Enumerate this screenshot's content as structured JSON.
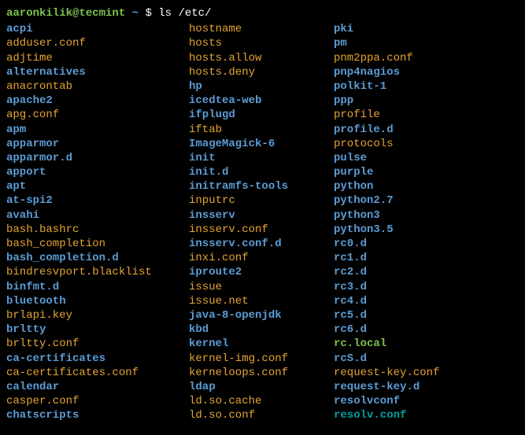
{
  "prompt": {
    "user_host": "aaronkilik@tecmint",
    "tilde": "~",
    "dollar": "$",
    "command": "ls /etc/"
  },
  "columns": [
    [
      {
        "name": "acpi",
        "type": "dir"
      },
      {
        "name": "adduser.conf",
        "type": "file"
      },
      {
        "name": "adjtime",
        "type": "file"
      },
      {
        "name": "alternatives",
        "type": "dir"
      },
      {
        "name": "anacrontab",
        "type": "file"
      },
      {
        "name": "apache2",
        "type": "dir"
      },
      {
        "name": "apg.conf",
        "type": "file"
      },
      {
        "name": "apm",
        "type": "dir"
      },
      {
        "name": "apparmor",
        "type": "dir"
      },
      {
        "name": "apparmor.d",
        "type": "dir"
      },
      {
        "name": "apport",
        "type": "dir"
      },
      {
        "name": "apt",
        "type": "dir"
      },
      {
        "name": "at-spi2",
        "type": "dir"
      },
      {
        "name": "avahi",
        "type": "dir"
      },
      {
        "name": "bash.bashrc",
        "type": "file"
      },
      {
        "name": "bash_completion",
        "type": "file"
      },
      {
        "name": "bash_completion.d",
        "type": "dir"
      },
      {
        "name": "bindresvport.blacklist",
        "type": "file"
      },
      {
        "name": "binfmt.d",
        "type": "dir"
      },
      {
        "name": "bluetooth",
        "type": "dir"
      },
      {
        "name": "brlapi.key",
        "type": "file"
      },
      {
        "name": "brltty",
        "type": "dir"
      },
      {
        "name": "brltty.conf",
        "type": "file"
      },
      {
        "name": "ca-certificates",
        "type": "dir"
      },
      {
        "name": "ca-certificates.conf",
        "type": "file"
      },
      {
        "name": "calendar",
        "type": "dir"
      },
      {
        "name": "casper.conf",
        "type": "file"
      },
      {
        "name": "chatscripts",
        "type": "dir"
      }
    ],
    [
      {
        "name": "hostname",
        "type": "file"
      },
      {
        "name": "hosts",
        "type": "file"
      },
      {
        "name": "hosts.allow",
        "type": "file"
      },
      {
        "name": "hosts.deny",
        "type": "file"
      },
      {
        "name": "hp",
        "type": "dir"
      },
      {
        "name": "icedtea-web",
        "type": "dir"
      },
      {
        "name": "ifplugd",
        "type": "dir"
      },
      {
        "name": "iftab",
        "type": "file"
      },
      {
        "name": "ImageMagick-6",
        "type": "dir"
      },
      {
        "name": "init",
        "type": "dir"
      },
      {
        "name": "init.d",
        "type": "dir"
      },
      {
        "name": "initramfs-tools",
        "type": "dir"
      },
      {
        "name": "inputrc",
        "type": "file"
      },
      {
        "name": "insserv",
        "type": "dir"
      },
      {
        "name": "insserv.conf",
        "type": "file"
      },
      {
        "name": "insserv.conf.d",
        "type": "dir"
      },
      {
        "name": "inxi.conf",
        "type": "file"
      },
      {
        "name": "iproute2",
        "type": "dir"
      },
      {
        "name": "issue",
        "type": "file"
      },
      {
        "name": "issue.net",
        "type": "file"
      },
      {
        "name": "java-8-openjdk",
        "type": "dir"
      },
      {
        "name": "kbd",
        "type": "dir"
      },
      {
        "name": "kernel",
        "type": "dir"
      },
      {
        "name": "kernel-img.conf",
        "type": "file"
      },
      {
        "name": "kerneloops.conf",
        "type": "file"
      },
      {
        "name": "ldap",
        "type": "dir"
      },
      {
        "name": "ld.so.cache",
        "type": "file"
      },
      {
        "name": "ld.so.conf",
        "type": "file"
      }
    ],
    [
      {
        "name": "pki",
        "type": "dir"
      },
      {
        "name": "pm",
        "type": "dir"
      },
      {
        "name": "pnm2ppa.conf",
        "type": "file"
      },
      {
        "name": "pnp4nagios",
        "type": "dir"
      },
      {
        "name": "polkit-1",
        "type": "dir"
      },
      {
        "name": "ppp",
        "type": "dir"
      },
      {
        "name": "profile",
        "type": "file"
      },
      {
        "name": "profile.d",
        "type": "dir"
      },
      {
        "name": "protocols",
        "type": "file"
      },
      {
        "name": "pulse",
        "type": "dir"
      },
      {
        "name": "purple",
        "type": "dir"
      },
      {
        "name": "python",
        "type": "dir"
      },
      {
        "name": "python2.7",
        "type": "dir"
      },
      {
        "name": "python3",
        "type": "dir"
      },
      {
        "name": "python3.5",
        "type": "dir"
      },
      {
        "name": "rc0.d",
        "type": "dir"
      },
      {
        "name": "rc1.d",
        "type": "dir"
      },
      {
        "name": "rc2.d",
        "type": "dir"
      },
      {
        "name": "rc3.d",
        "type": "dir"
      },
      {
        "name": "rc4.d",
        "type": "dir"
      },
      {
        "name": "rc5.d",
        "type": "dir"
      },
      {
        "name": "rc6.d",
        "type": "dir"
      },
      {
        "name": "rc.local",
        "type": "exec"
      },
      {
        "name": "rcS.d",
        "type": "dir"
      },
      {
        "name": "request-key.conf",
        "type": "file"
      },
      {
        "name": "request-key.d",
        "type": "dir"
      },
      {
        "name": "resolvconf",
        "type": "dir"
      },
      {
        "name": "resolv.conf",
        "type": "special"
      }
    ]
  ]
}
